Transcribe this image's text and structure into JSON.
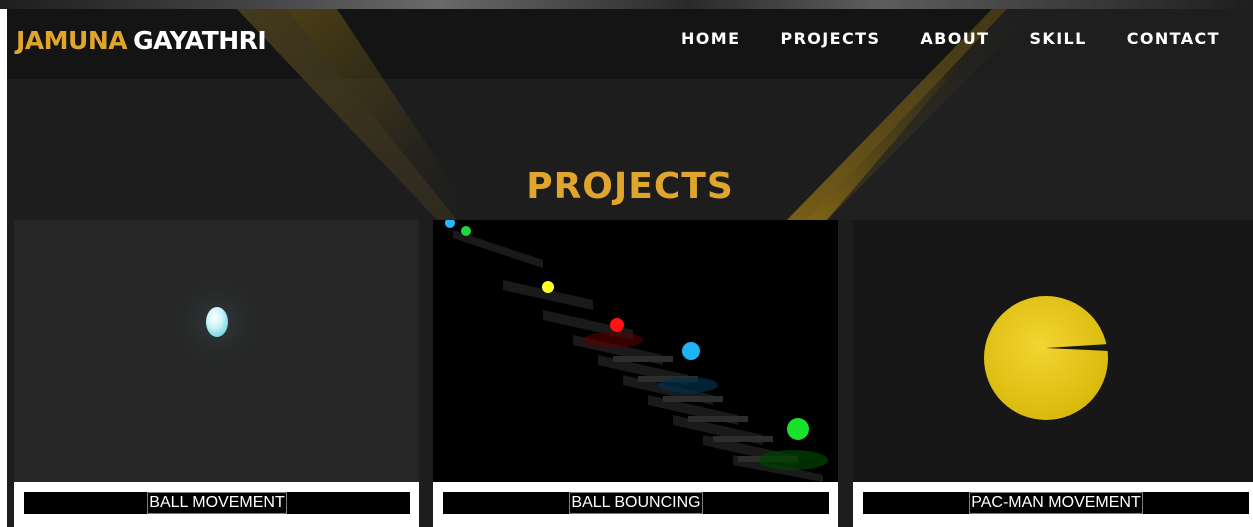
{
  "brand": {
    "first": "JAMUNA",
    "last": "GAYATHRI"
  },
  "nav": [
    {
      "label": "HOME"
    },
    {
      "label": "PROJECTS"
    },
    {
      "label": "ABOUT"
    },
    {
      "label": "SKILL"
    },
    {
      "label": "CONTACT"
    }
  ],
  "section": {
    "title": "PROJECTS"
  },
  "projects": [
    {
      "title": "BALL MOVEMENT"
    },
    {
      "title": "BALL BOUNCING"
    },
    {
      "title": "PAC-MAN MOVEMENT"
    }
  ],
  "colors": {
    "accent": "#e0a52c",
    "dark": "#1b1b1b",
    "caption_bg": "#000000"
  }
}
